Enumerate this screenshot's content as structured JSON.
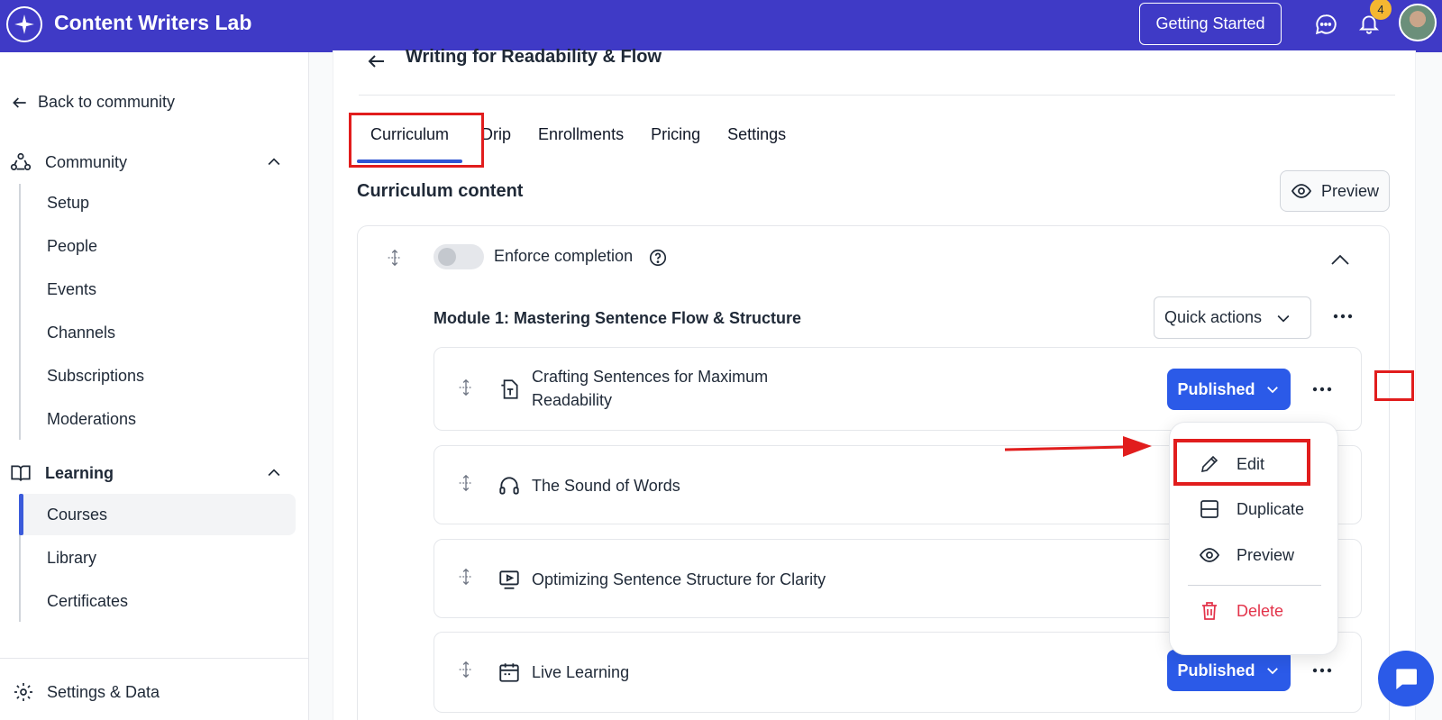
{
  "app": {
    "title": "Content Writers Lab",
    "getting_started": "Getting Started",
    "notification_count": "4"
  },
  "sidebar": {
    "back": "Back to community",
    "community": {
      "label": "Community",
      "items": [
        "Setup",
        "People",
        "Events",
        "Channels",
        "Subscriptions",
        "Moderations"
      ]
    },
    "learning": {
      "label": "Learning",
      "items": [
        "Courses",
        "Library",
        "Certificates"
      ],
      "active": "Courses"
    },
    "settings": "Settings & Data"
  },
  "course": {
    "title": "Writing for Readability & Flow"
  },
  "tabs": [
    "Curriculum",
    "Drip",
    "Enrollments",
    "Pricing",
    "Settings"
  ],
  "curriculum": {
    "heading": "Curriculum content",
    "preview": "Preview",
    "enforce_label": "Enforce completion",
    "enforce_on": false,
    "module": {
      "title": "Module 1: Mastering Sentence Flow & Structure",
      "quick_actions": "Quick actions"
    },
    "lessons": [
      {
        "title": "Crafting Sentences for Maximum Readability",
        "status": "Published",
        "icon": "text-document-icon"
      },
      {
        "title": "The Sound of Words",
        "icon": "headphones-icon"
      },
      {
        "title": "Optimizing Sentence Structure for Clarity",
        "icon": "video-icon"
      },
      {
        "title": "Live Learning",
        "status": "Published",
        "icon": "calendar-icon"
      }
    ]
  },
  "menu": {
    "edit": "Edit",
    "duplicate": "Duplicate",
    "preview": "Preview",
    "delete": "Delete"
  },
  "colors": {
    "brand": "#3f3ac6",
    "primary": "#2b5ae8",
    "annotation": "#e11d1d",
    "danger": "#e3334a"
  }
}
